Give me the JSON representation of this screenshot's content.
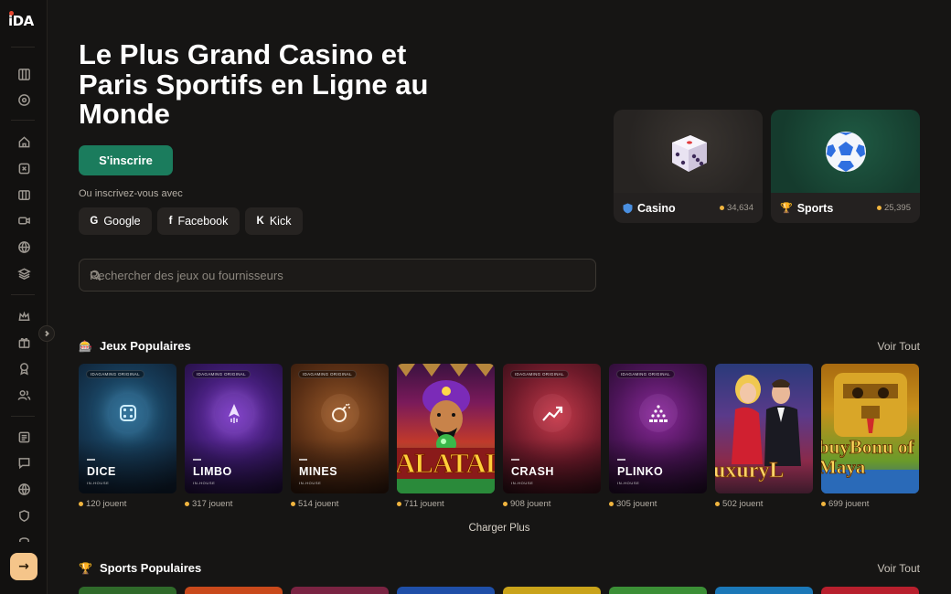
{
  "brand": {
    "logo_text": "iDA"
  },
  "sidebar": {
    "icons": [
      "dashboard-icon",
      "target-icon",
      "home-icon",
      "casino-icon",
      "slots-icon",
      "video-icon",
      "ball-icon",
      "layers-icon",
      "crown-icon",
      "gift-icon",
      "award-icon",
      "users-icon",
      "news-icon",
      "chat-icon",
      "globe-icon",
      "shield-icon",
      "headset-icon"
    ],
    "enter_symbol": "→"
  },
  "hero": {
    "title": "Le Plus Grand Casino et Paris Sportifs en Ligne au Monde",
    "signup_label": "S'inscrire",
    "or_text": "Ou inscrivez-vous avec",
    "social": [
      {
        "icon": "G",
        "label": "Google"
      },
      {
        "icon": "f",
        "label": "Facebook"
      },
      {
        "icon": "K",
        "label": "Kick"
      }
    ]
  },
  "search": {
    "placeholder": "Rechercher des jeux ou fournisseurs"
  },
  "categories": [
    {
      "label": "Casino",
      "count": "34,634",
      "icon": "shield-icon"
    },
    {
      "label": "Sports",
      "count": "25,395",
      "icon": "trophy-icon"
    }
  ],
  "popular_games": {
    "title": "Jeux Populaires",
    "view_all": "Voir Tout",
    "badge_text": "IDAGAMING ORIGINAL",
    "inhouse_text": "IN-HOUSE",
    "games": [
      {
        "name": "DICE",
        "players": "120 jouent",
        "original": true
      },
      {
        "name": "LIMBO",
        "players": "317 jouent",
        "original": true
      },
      {
        "name": "MINES",
        "players": "514 jouent",
        "original": true
      },
      {
        "name": "ALATAL",
        "players": "711 jouent",
        "original": false
      },
      {
        "name": "CRASH",
        "players": "908 jouent",
        "original": true
      },
      {
        "name": "PLINKO",
        "players": "305 jouent",
        "original": true
      },
      {
        "name": "uxuryL",
        "players": "502 jouent",
        "original": false
      },
      {
        "name": "buyBonu of Maya",
        "players": "699 jouent",
        "original": false
      }
    ],
    "load_more": "Charger Plus"
  },
  "popular_sports": {
    "title": "Sports Populaires",
    "view_all": "Voir Tout",
    "tile_colors": [
      "#2f6a2a",
      "#c9491b",
      "#7a2342",
      "#1f4fa8",
      "#c9a31a",
      "#3b8f36",
      "#1b78b8",
      "#b81f2d"
    ]
  },
  "colors": {
    "accent_green": "#1b7c5d",
    "enter_button": "#f5c58a",
    "player_dot": "#f1b53f"
  }
}
